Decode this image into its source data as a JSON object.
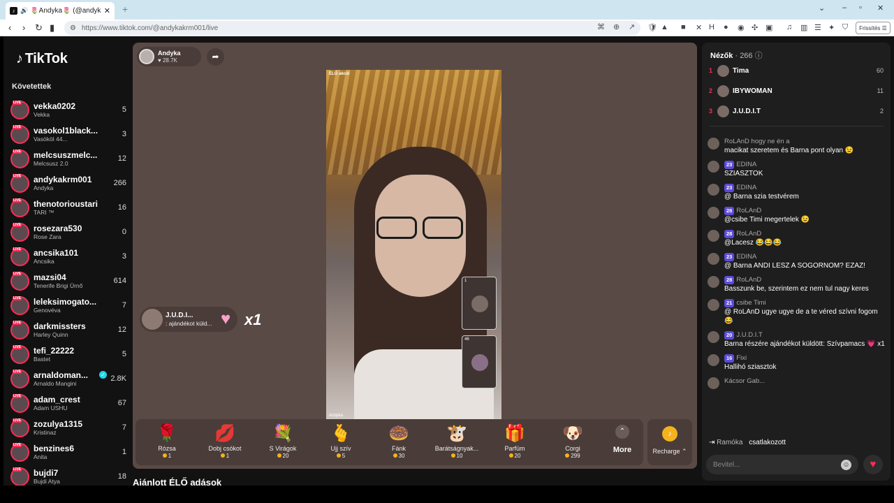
{
  "browser": {
    "tab_title": "🌷Andyka🌷 (@andykakrm0...",
    "url": "https://www.tiktok.com/@andykakrm001/live",
    "refresh_label": "Frissítés"
  },
  "sidebar": {
    "logo": "TikTok",
    "following_title": "Követettek",
    "items": [
      {
        "name": "vekka0202",
        "sub": "Vekka",
        "count": "5"
      },
      {
        "name": "vasokol1black...",
        "sub": "Vasököl 44...",
        "count": "3"
      },
      {
        "name": "melcsuszmelc...",
        "sub": "Melcsusz 2.0",
        "count": "12"
      },
      {
        "name": "andykakrm001",
        "sub": "Andyka",
        "count": "266"
      },
      {
        "name": "thenotorioustari",
        "sub": "TARI ™",
        "count": "16"
      },
      {
        "name": "rosezara530",
        "sub": "Rose Zara",
        "count": "0"
      },
      {
        "name": "ancsika101",
        "sub": "Ancsika",
        "count": "3"
      },
      {
        "name": "mazsi04",
        "sub": "Tenerife Brigi Ürnő",
        "count": "614"
      },
      {
        "name": "leleksimogato...",
        "sub": "Genovéva",
        "count": "7"
      },
      {
        "name": "darkmissters",
        "sub": "Harley Quinn",
        "count": "12"
      },
      {
        "name": "tefi_22222",
        "sub": "Bastet",
        "count": "5"
      },
      {
        "name": "arnaldoman...",
        "sub": "Arnaldo Mangini",
        "count": "2.8K",
        "verified": true
      },
      {
        "name": "adam_crest",
        "sub": "Adam USHU",
        "count": "67"
      },
      {
        "name": "zozulya1315",
        "sub": "Kristinaz",
        "count": "7"
      },
      {
        "name": "benzines6",
        "sub": "Anita",
        "count": "1"
      },
      {
        "name": "bujdi7",
        "sub": "Bujdi Atya",
        "count": "18"
      }
    ]
  },
  "player": {
    "host_name": "Andyka",
    "host_likes": "28.7K",
    "video_top_label": "ÉLŐ akció",
    "video_bottom_label": "Andyka",
    "guest1_count": "1",
    "guest2_count": "46",
    "gift_notice_name": "J.U.D.I...",
    "gift_notice_text": ": ajándékot küld...",
    "gift_multiplier": "x1"
  },
  "gifts": [
    {
      "label": "Rózsa",
      "price": "1",
      "icon": "🌹"
    },
    {
      "label": "Dobj csókot",
      "price": "1",
      "icon": "💋"
    },
    {
      "label": "S Virágok",
      "price": "20",
      "icon": "💐"
    },
    {
      "label": "Ujj szív",
      "price": "5",
      "icon": "🫰"
    },
    {
      "label": "Fánk",
      "price": "30",
      "icon": "🍩"
    },
    {
      "label": "Barátságnyak...",
      "price": "10",
      "icon": "🐮"
    },
    {
      "label": "Parfüm",
      "price": "20",
      "icon": "🎁"
    },
    {
      "label": "Corgi",
      "price": "299",
      "icon": "🐶"
    }
  ],
  "more_label": "More",
  "recharge_label": "Recharge",
  "recommended_title": "Ajánlott ÉLŐ adások",
  "chat": {
    "viewers_title": "Nézők",
    "viewers_count": "· 266",
    "top_viewers": [
      {
        "rank": "1",
        "name": "Tima",
        "score": "60"
      },
      {
        "rank": "2",
        "name": "IBYWOMAN",
        "score": "11"
      },
      {
        "rank": "3",
        "name": "J.U.D.I.T",
        "score": "2"
      }
    ],
    "messages": [
      {
        "level": "",
        "who": "RoLAnD hogy ne én a",
        "body": "macikat szeretem és Barna pont olyan 😉"
      },
      {
        "level": "23",
        "who": "EDINA",
        "body": "SZIASZTOK"
      },
      {
        "level": "23",
        "who": "EDINA",
        "body": "@ Barna szia testvérem"
      },
      {
        "level": "28",
        "who": "RoLAnD",
        "body": "@csibe Timi megertelek 😉"
      },
      {
        "level": "28",
        "who": "RoLAnD",
        "body": "@Lacesz 😂😂😂"
      },
      {
        "level": "23",
        "who": "EDINA",
        "body": "@ Barna ANDI LESZ A SOGORNOM? EZAZ!"
      },
      {
        "level": "28",
        "who": "RoLAnD",
        "body": "Basszunk be, szerintem ez nem tul nagy keres"
      },
      {
        "level": "21",
        "who": "csibe Timi",
        "body": "@ RoLAnD ugye ugye de a te véred szívni fogom 😂"
      },
      {
        "level": "20",
        "who": "J.U.D.I.T",
        "body": "Barna részére ajándékot küldött: Szívpamacs 💗 x1"
      },
      {
        "level": "16",
        "who": "Fixi",
        "body": "Hallihó sziasztok"
      },
      {
        "level": "",
        "who": "Kácsor Gab...",
        "body": ""
      }
    ],
    "join_name": "Ramóka",
    "join_text": "csatlakozott",
    "input_placeholder": "Bevitel..."
  }
}
